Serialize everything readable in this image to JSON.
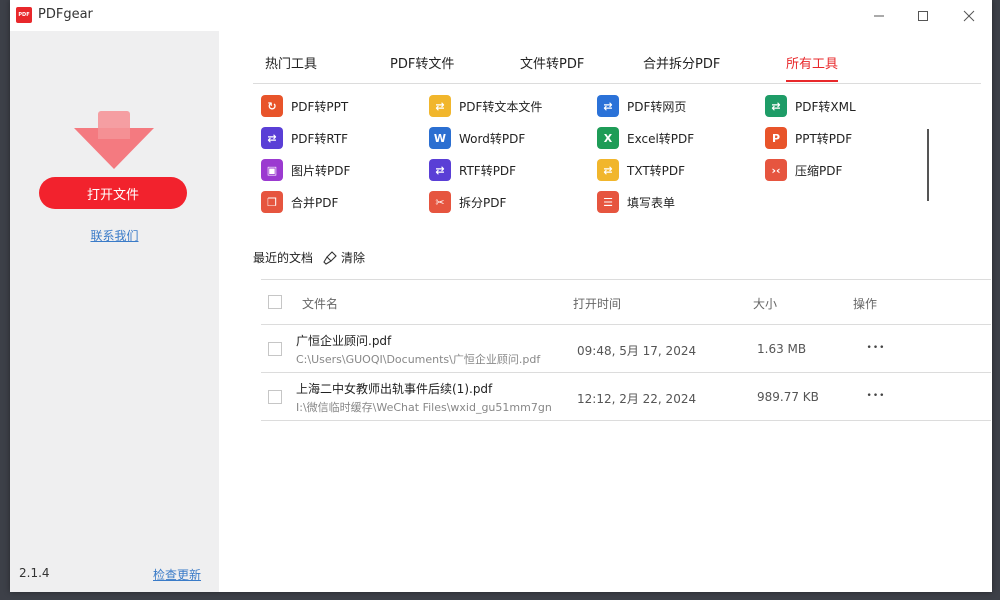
{
  "window": {
    "title": "PDFgear",
    "logo_text": "PDFgear",
    "controls": [
      "minimize",
      "maximize",
      "close"
    ]
  },
  "sidebar": {
    "open_button": "打开文件",
    "contact_link": "联系我们",
    "version": "2.1.4",
    "update_link": "检查更新"
  },
  "tabs": [
    {
      "label": "热门工具",
      "active": false
    },
    {
      "label": "PDF转文件",
      "active": false
    },
    {
      "label": "文件转PDF",
      "active": false
    },
    {
      "label": "合并拆分PDF",
      "active": false
    },
    {
      "label": "所有工具",
      "active": true
    }
  ],
  "tools": [
    {
      "label": "PDF转PPT",
      "icon": "pdf-to-ppt-icon",
      "color": "#e8542a"
    },
    {
      "label": "PDF转文本文件",
      "icon": "pdf-to-txt-icon",
      "color": "#f1b62c"
    },
    {
      "label": "PDF转网页",
      "icon": "pdf-to-html-icon",
      "color": "#2b72d8"
    },
    {
      "label": "PDF转XML",
      "icon": "pdf-to-xml-icon",
      "color": "#1e9c67"
    },
    {
      "label": "PDF转RTF",
      "icon": "pdf-to-rtf-icon",
      "color": "#5a3fd6"
    },
    {
      "label": "Word转PDF",
      "icon": "word-to-pdf-icon",
      "color": "#2b6fd1"
    },
    {
      "label": "Excel转PDF",
      "icon": "excel-to-pdf-icon",
      "color": "#1e9c57"
    },
    {
      "label": "PPT转PDF",
      "icon": "ppt-to-pdf-icon",
      "color": "#e8542a"
    },
    {
      "label": "图片转PDF",
      "icon": "image-to-pdf-icon",
      "color": "#9b3ad0"
    },
    {
      "label": "RTF转PDF",
      "icon": "rtf-to-pdf-icon",
      "color": "#5a3fd6"
    },
    {
      "label": "TXT转PDF",
      "icon": "txt-to-pdf-icon",
      "color": "#f1b62c"
    },
    {
      "label": "压缩PDF",
      "icon": "compress-pdf-icon",
      "color": "#e6553f"
    },
    {
      "label": "合并PDF",
      "icon": "merge-pdf-icon",
      "color": "#e6553f"
    },
    {
      "label": "拆分PDF",
      "icon": "split-pdf-icon",
      "color": "#e6553f"
    },
    {
      "label": "填写表单",
      "icon": "fill-form-icon",
      "color": "#e6553f"
    }
  ],
  "recent": {
    "title": "最近的文档",
    "clear_label": "清除",
    "columns": {
      "name": "文件名",
      "time": "打开时间",
      "size": "大小",
      "actions": "操作"
    },
    "rows": [
      {
        "name": "广恒企业顾问.pdf",
        "path": "C:\\Users\\GUOQI\\Documents\\广恒企业顾问.pdf",
        "time": "09:48, 5月 17, 2024",
        "size": "1.63 MB",
        "more": "•••"
      },
      {
        "name": "上海二中女教师出轨事件后续(1).pdf",
        "path": "I:\\微信临时缓存\\WeChat Files\\wxid_gu51mm7gn",
        "time": "12:12, 2月 22, 2024",
        "size": "989.77 KB",
        "more": "•••"
      }
    ]
  },
  "colors": {
    "accent": "#e8282b",
    "open_button": "#f2222d",
    "link": "#3a7bc8",
    "sidebar_bg": "#efeff0"
  }
}
